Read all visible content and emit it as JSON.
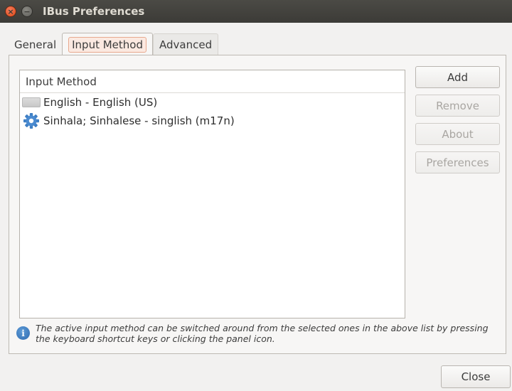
{
  "window": {
    "title": "IBus Preferences",
    "close_glyph": "×",
    "minimize_glyph": "−"
  },
  "tabs": [
    {
      "label": "General",
      "active": false
    },
    {
      "label": "Input Method",
      "active": true
    },
    {
      "label": "Advanced",
      "active": false
    }
  ],
  "input_method_list": {
    "header": "Input Method",
    "items": [
      {
        "label": "English - English (US)",
        "icon": "keyboard-icon"
      },
      {
        "label": "Sinhala; Sinhalese - singlish (m17n)",
        "icon": "gear-icon"
      }
    ]
  },
  "side_buttons": {
    "add": "Add",
    "remove": "Remove",
    "about": "About",
    "preferences": "Preferences"
  },
  "info": {
    "icon_glyph": "i",
    "line1": "The active input method can be switched around from the selected ones in the above list by pressing",
    "line2": "the keyboard shortcut keys or clicking the panel icon."
  },
  "footer": {
    "close_label": "Close"
  },
  "colors": {
    "titlebar": "#3c3b37",
    "close_button": "#df4a16",
    "active_tab_highlight": "#e8a98e",
    "info_icon": "#2f6bb0"
  }
}
